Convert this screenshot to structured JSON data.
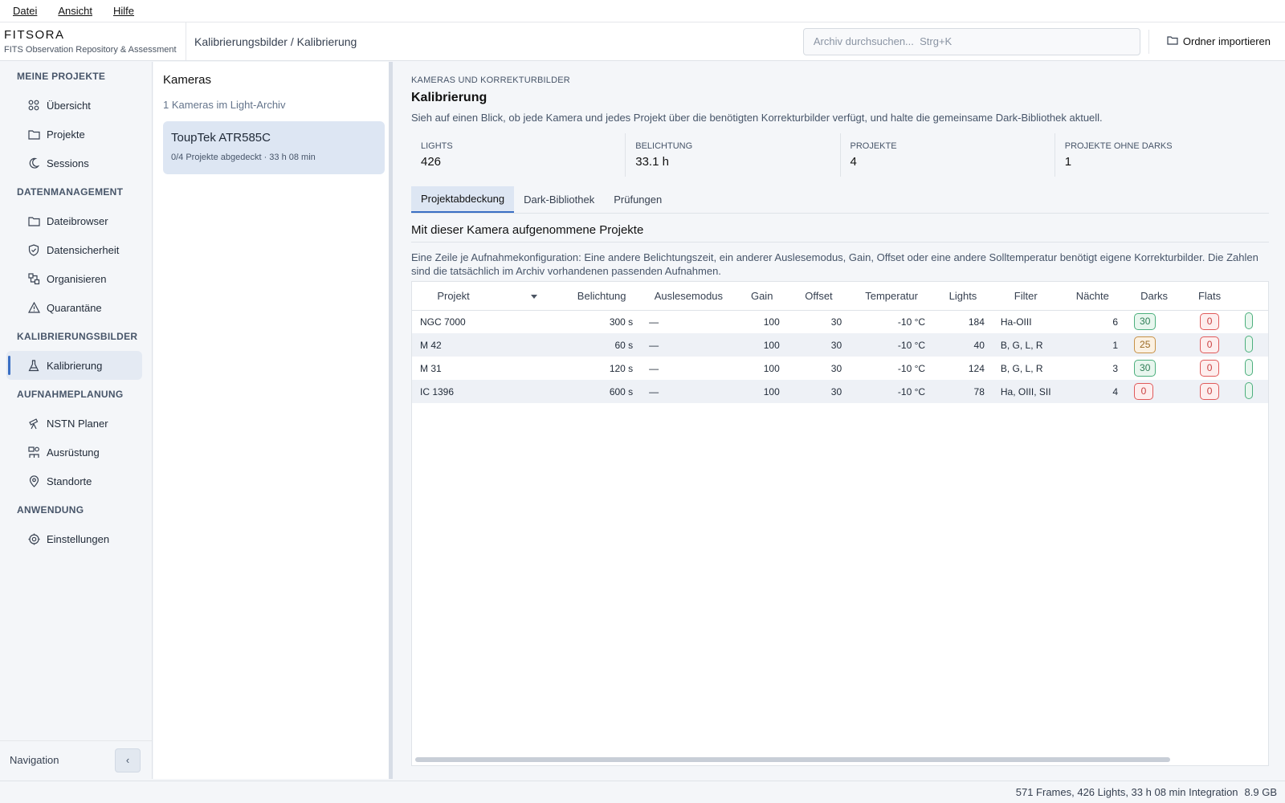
{
  "menu": {
    "file": "Datei",
    "view": "Ansicht",
    "help": "Hilfe"
  },
  "header": {
    "app_name": "FITSORA",
    "app_subtitle": "FITS Observation Repository & Assessment",
    "breadcrumb": "Kalibrierungsbilder / Kalibrierung",
    "search_placeholder": "Archiv durchsuchen...  Strg+K",
    "import_label": "Ordner importieren"
  },
  "sidebar": {
    "sections": [
      {
        "title": "MEINE PROJEKTE",
        "items": [
          {
            "label": "Übersicht",
            "icon": "grid-icon"
          },
          {
            "label": "Projekte",
            "icon": "folder-icon"
          },
          {
            "label": "Sessions",
            "icon": "moon-icon"
          }
        ]
      },
      {
        "title": "DATENMANAGEMENT",
        "items": [
          {
            "label": "Dateibrowser",
            "icon": "folder-icon"
          },
          {
            "label": "Datensicherheit",
            "icon": "shield-check-icon"
          },
          {
            "label": "Organisieren",
            "icon": "organize-icon"
          },
          {
            "label": "Quarantäne",
            "icon": "warning-icon"
          }
        ]
      },
      {
        "title": "KALIBRIERUNGSBILDER",
        "items": [
          {
            "label": "Kalibrierung",
            "icon": "flask-icon",
            "active": true
          }
        ]
      },
      {
        "title": "AUFNAHMEPLANUNG",
        "items": [
          {
            "label": "NSTN Planer",
            "icon": "telescope-icon"
          },
          {
            "label": "Ausrüstung",
            "icon": "equipment-icon"
          },
          {
            "label": "Standorte",
            "icon": "map-pin-icon"
          }
        ]
      },
      {
        "title": "ANWENDUNG",
        "items": [
          {
            "label": "Einstellungen",
            "icon": "settings-icon"
          }
        ]
      }
    ],
    "footer_label": "Navigation",
    "collapse_glyph": "‹"
  },
  "cameras": {
    "title": "Kameras",
    "count_text": "1 Kameras im Light-Archiv",
    "list": [
      {
        "name": "ToupTek ATR585C",
        "sub": "0/4 Projekte abgedeckt · 33 h 08 min"
      }
    ]
  },
  "main": {
    "eyebrow": "KAMERAS UND KORREKTURBILDER",
    "title": "Kalibrierung",
    "description": "Sieh auf einen Blick, ob jede Kamera und jedes Projekt über die benötigten Korrekturbilder verfügt, und halte die gemeinsame Dark-Bibliothek aktuell.",
    "stats": [
      {
        "label": "LIGHTS",
        "value": "426"
      },
      {
        "label": "BELICHTUNG",
        "value": "33.1 h"
      },
      {
        "label": "PROJEKTE",
        "value": "4"
      },
      {
        "label": "PROJEKTE OHNE DARKS",
        "value": "1"
      }
    ],
    "tabs": [
      "Projektabdeckung",
      "Dark-Bibliothek",
      "Prüfungen"
    ],
    "section_title": "Mit dieser Kamera aufgenommene Projekte",
    "section_desc": "Eine Zeile je Aufnahmekonfiguration: Eine andere Belichtungszeit, ein anderer Auslesemodus, Gain, Offset oder eine andere Solltemperatur benötigt eigene Korrekturbilder. Die Zahlen sind die tatsächlich im Archiv vorhandenen passenden Aufnahmen.",
    "table": {
      "columns": [
        "Projekt",
        "Belichtung",
        "Auslesemodus",
        "Gain",
        "Offset",
        "Temperatur",
        "Lights",
        "Filter",
        "Nächte",
        "Darks",
        "Flats"
      ],
      "rows": [
        {
          "project": "NGC 7000",
          "exposure": "300 s",
          "readout": "—",
          "gain": "100",
          "offset": "30",
          "temp": "-10 °C",
          "lights": "184",
          "filter": "Ha-OIII",
          "nights": "6",
          "darks": "30",
          "darks_status": "green",
          "flats": "0",
          "flats_status": "red"
        },
        {
          "project": "M 42",
          "exposure": "60 s",
          "readout": "—",
          "gain": "100",
          "offset": "30",
          "temp": "-10 °C",
          "lights": "40",
          "filter": "B, G, L, R",
          "nights": "1",
          "darks": "25",
          "darks_status": "amber",
          "flats": "0",
          "flats_status": "red"
        },
        {
          "project": "M 31",
          "exposure": "120 s",
          "readout": "—",
          "gain": "100",
          "offset": "30",
          "temp": "-10 °C",
          "lights": "124",
          "filter": "B, G, L, R",
          "nights": "3",
          "darks": "30",
          "darks_status": "green",
          "flats": "0",
          "flats_status": "red"
        },
        {
          "project": "IC 1396",
          "exposure": "600 s",
          "readout": "—",
          "gain": "100",
          "offset": "30",
          "temp": "-10 °C",
          "lights": "78",
          "filter": "Ha, OIII, SII",
          "nights": "4",
          "darks": "0",
          "darks_status": "red",
          "flats": "0",
          "flats_status": "red"
        }
      ]
    }
  },
  "statusbar": {
    "summary": "571 Frames, 426 Lights, 33 h 08 min Integration",
    "size": "8.9 GB"
  },
  "colors": {
    "accent": "#3a6fc4",
    "ok": "#4caf7d",
    "warn": "#c79146",
    "error": "#e05a5a"
  }
}
